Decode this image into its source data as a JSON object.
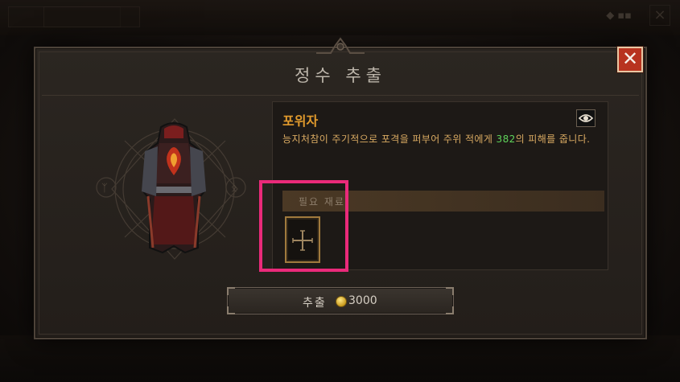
{
  "background": {
    "tab_1": "",
    "tab_2": "",
    "gold_label": "",
    "close_glyph": "×"
  },
  "dialog": {
    "title": "정수 추출",
    "close_icon": "close-icon"
  },
  "aspect": {
    "name": "포위자",
    "description_before": "능지처참이 주기적으로 포격을 퍼부어 주위 적에게 ",
    "description_value": "382",
    "description_after": "의 피해를 줍니다.",
    "value_color": "#5fd35a",
    "name_color": "#e29b2d"
  },
  "materials": {
    "label": "필요 재료",
    "slot_icon": "cross-icon"
  },
  "extract": {
    "label": "추출",
    "cost": "3000",
    "currency_icon": "gold-coin-icon"
  },
  "colors": {
    "highlight": "#ea2a7a",
    "close_button": "#b8341f"
  }
}
